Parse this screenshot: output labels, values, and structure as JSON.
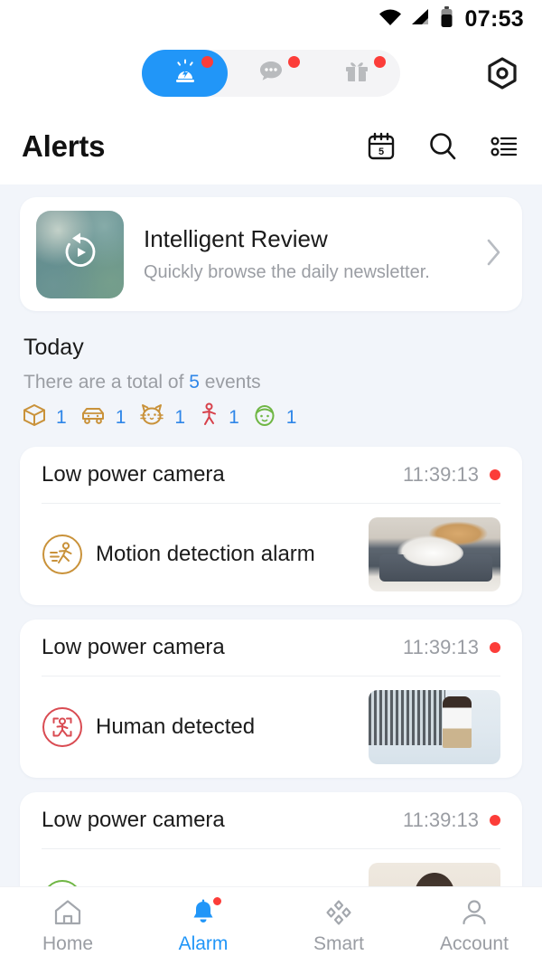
{
  "status_bar": {
    "time": "07:53",
    "wifi_icon": "wifi-icon",
    "signal_icon": "cellular-signal-icon",
    "battery_icon": "battery-icon"
  },
  "top_bar": {
    "segments": [
      {
        "id": "alerts",
        "icon": "alarm-siren-icon",
        "badge": true,
        "active": true
      },
      {
        "id": "messages",
        "icon": "chat-bubble-icon",
        "badge": true,
        "active": false
      },
      {
        "id": "gifts",
        "icon": "gift-box-icon",
        "badge": true,
        "active": false
      }
    ],
    "settings_icon": "hex-settings-icon"
  },
  "header": {
    "title": "Alerts",
    "icons": [
      {
        "name": "calendar-icon",
        "day": "5"
      },
      {
        "name": "search-icon"
      },
      {
        "name": "filter-list-icon"
      }
    ]
  },
  "intelligent_review": {
    "title": "Intelligent Review",
    "subtitle": "Quickly browse the daily newsletter.",
    "thumb_icon": "replay-play-icon",
    "chevron": "chevron-right-icon"
  },
  "today": {
    "heading": "Today",
    "summary_prefix": "There are a total of ",
    "summary_count": "5",
    "summary_suffix": " events",
    "counts": [
      {
        "icon": "package-box-icon",
        "value": "1",
        "color": "#C9923A"
      },
      {
        "icon": "vehicle-car-icon",
        "value": "1",
        "color": "#C9923A"
      },
      {
        "icon": "pet-cat-icon",
        "value": "1",
        "color": "#C9923A"
      },
      {
        "icon": "motion-person-icon",
        "value": "1",
        "color": "#D7404A"
      },
      {
        "icon": "face-detect-icon",
        "value": "1",
        "color": "#6FB644"
      }
    ]
  },
  "alerts": [
    {
      "device": "Low power camera",
      "time": "11:39:13",
      "unread": true,
      "event_label": "Motion detection alarm",
      "event_icon": "motion-detection-icon",
      "event_color": "#C9923A",
      "thumb": "thumb-cat",
      "thumb_name": "event-thumbnail-cat"
    },
    {
      "device": "Low power camera",
      "time": "11:39:13",
      "unread": true,
      "event_label": "Human detected",
      "event_icon": "human-detected-icon",
      "event_color": "#D94B52",
      "thumb": "thumb-person",
      "thumb_name": "event-thumbnail-person"
    },
    {
      "device": "Low power camera",
      "time": "11:39:13",
      "unread": true,
      "event_label": "",
      "event_icon": "face-detected-icon",
      "event_color": "#6FB644",
      "thumb": "thumb-face",
      "thumb_name": "event-thumbnail-face"
    }
  ],
  "bottom_nav": [
    {
      "label": "Home",
      "icon": "home-icon",
      "active": false,
      "badge": false
    },
    {
      "label": "Alarm",
      "icon": "bell-icon",
      "active": true,
      "badge": true
    },
    {
      "label": "Smart",
      "icon": "smart-diamonds-icon",
      "active": false,
      "badge": false
    },
    {
      "label": "Account",
      "icon": "person-icon",
      "active": false,
      "badge": false
    }
  ],
  "colors": {
    "accent": "#2196F8",
    "badge_red": "#FC3D39",
    "page_bg": "#F2F5FA",
    "card_bg": "#FFFFFF",
    "muted_text": "#9A9DA3"
  }
}
